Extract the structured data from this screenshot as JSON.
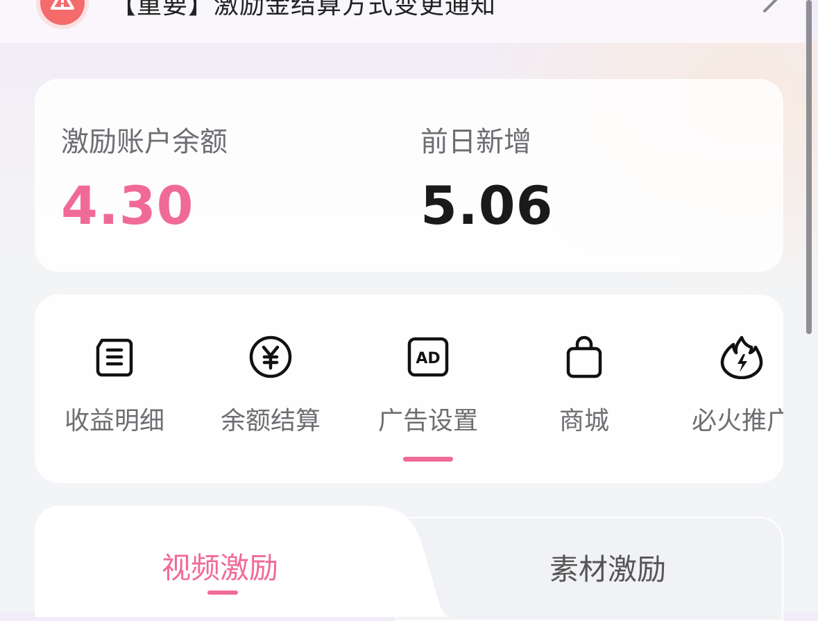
{
  "notice": {
    "title": "【重要】激励金结算方式变更通知",
    "icon": "warning-icon",
    "chevron": "chevron-right-icon"
  },
  "balance": {
    "account_label": "激励账户余额",
    "account_value": "4.30",
    "yesterday_label": "前日新增",
    "yesterday_value": "5.06",
    "account_color": "#f06a98"
  },
  "menu": {
    "items": [
      {
        "label": "收益明细",
        "icon": "list-icon"
      },
      {
        "label": "余额结算",
        "icon": "yuan-icon"
      },
      {
        "label": "广告设置",
        "icon": "ad-icon"
      },
      {
        "label": "商城",
        "icon": "shopping-bag-icon"
      },
      {
        "label": "必火推广",
        "icon": "fire-icon"
      }
    ],
    "active_index": 2
  },
  "tabs": {
    "items": [
      {
        "label": "视频激励"
      },
      {
        "label": "素材激励"
      }
    ],
    "active_index": 0,
    "accent": "#f06a98"
  }
}
